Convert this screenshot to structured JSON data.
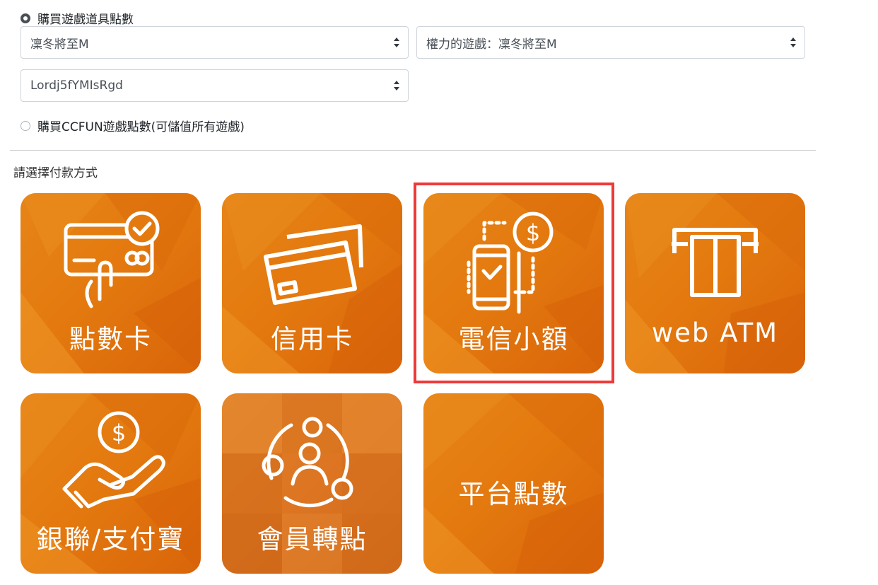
{
  "game_purchase": {
    "option_item_points": "購買遊戲道具點數",
    "option_ccfun_points": "購買CCFUN遊戲點數(可儲值所有遊戲)",
    "selected_option": "item_points",
    "select_server": "凜冬將至M",
    "select_game": "權力的遊戲：凜冬將至M",
    "select_character": "Lordj5fYMIsRgd"
  },
  "payment": {
    "section_title": "請選擇付款方式",
    "selected_method": "電信小額",
    "methods": [
      {
        "label": "點數卡",
        "icon": "card-touch-icon"
      },
      {
        "label": "信用卡",
        "icon": "credit-cards-icon"
      },
      {
        "label": "電信小額",
        "icon": "phone-payment-icon"
      },
      {
        "label": "web ATM",
        "icon": "atm-icon"
      },
      {
        "label": "銀聯/支付寶",
        "icon": "hand-coin-icon"
      },
      {
        "label": "會員轉點",
        "icon": "member-network-icon"
      },
      {
        "label": "平台點數",
        "icon": ""
      }
    ]
  },
  "colors": {
    "tile_orange": "#e47a0f",
    "highlight_red": "#ee3a3a"
  }
}
